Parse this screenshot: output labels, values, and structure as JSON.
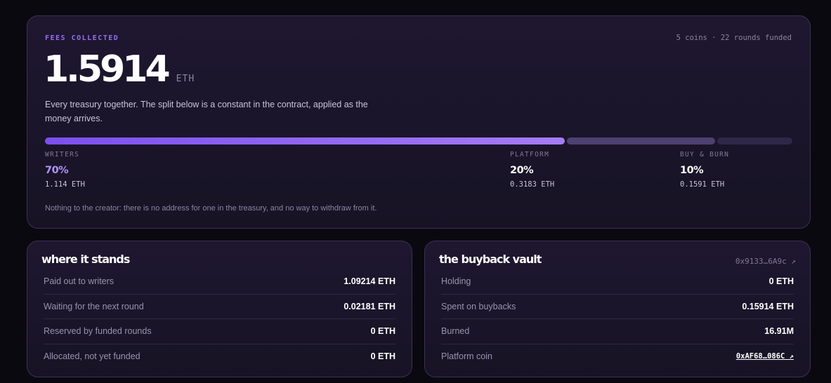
{
  "fees": {
    "eyebrow": "FEES COLLECTED",
    "meta": "5 coins · 22 rounds funded",
    "total": "1.5914",
    "unit": "ETH",
    "description": "Every treasury together. The split below is a constant in the contract, applied as the money arrives.",
    "split": [
      {
        "label": "WRITERS",
        "percent": "70%",
        "eth": "1.114 ETH",
        "share": 0.7,
        "color": "#8b5cf6"
      },
      {
        "label": "PLATFORM",
        "percent": "20%",
        "eth": "0.3183 ETH",
        "share": 0.2,
        "color": "#4d4170"
      },
      {
        "label": "BUY & BURN",
        "percent": "10%",
        "eth": "0.1591 ETH",
        "share": 0.1,
        "color": "#2e2747"
      }
    ],
    "footnote": "Nothing to the creator: there is no address for one in the treasury, and no way to withdraw from it."
  },
  "stands": {
    "title": "where it stands",
    "rows": [
      {
        "label": "Paid out to writers",
        "value": "1.09214 ETH"
      },
      {
        "label": "Waiting for the next round",
        "value": "0.02181 ETH"
      },
      {
        "label": "Reserved by funded rounds",
        "value": "0 ETH"
      },
      {
        "label": "Allocated, not yet funded",
        "value": "0 ETH"
      }
    ]
  },
  "vault": {
    "title": "the buyback vault",
    "address": "0x9133…6A9c ↗",
    "rows": [
      {
        "label": "Holding",
        "value": "0 ETH"
      },
      {
        "label": "Spent on buybacks",
        "value": "0.15914 ETH"
      },
      {
        "label": "Burned",
        "value": "16.91M"
      },
      {
        "label": "Platform coin",
        "value": "0xAF68…086C ↗"
      }
    ]
  }
}
